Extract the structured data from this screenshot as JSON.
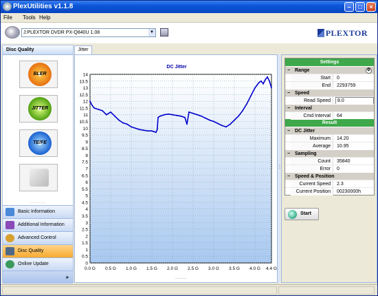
{
  "window": {
    "title": "PlexUtilities v1.1.8"
  },
  "menu": {
    "file": "File",
    "tools": "Tools",
    "help": "Help"
  },
  "toolbar": {
    "drive": "J:PLEXTOR DVDR   PX-Q840U  1.08",
    "logo": "PLEXTOR"
  },
  "left": {
    "header": "Disc Quality",
    "buttons": {
      "bler": "BLER",
      "jitter": "JITTER",
      "tefe": "TE/FE"
    },
    "nav": [
      {
        "label": "Basic Information"
      },
      {
        "label": "Additional Information"
      },
      {
        "label": "Advanced Control"
      },
      {
        "label": "Disc Quality"
      },
      {
        "label": "Online Update"
      }
    ]
  },
  "tab": {
    "label": "Jitter"
  },
  "chart_data": {
    "type": "line",
    "title": "DC Jitter",
    "xlabel": "",
    "ylabel": "",
    "x_ticks": [
      "0.0 G",
      "0.5 G",
      "1.0 G",
      "1.5 G",
      "2.0 G",
      "2.5 G",
      "3.0 G",
      "3.5 G",
      "4.0 G",
      "4.4 G"
    ],
    "x_tick_values": [
      0,
      0.5,
      1.0,
      1.5,
      2.0,
      2.5,
      3.0,
      3.5,
      4.0,
      4.4
    ],
    "xlim": [
      0,
      4.4
    ],
    "ylim": [
      0,
      14
    ],
    "y_ticks": [
      "0",
      "0.5",
      "1",
      "1.5",
      "2",
      "2.5",
      "3",
      "3.5",
      "4",
      "4.5",
      "5",
      "5.5",
      "6",
      "6.5",
      "7",
      "7.5",
      "8",
      "8.5",
      "9",
      "9.5",
      "10",
      "10.5",
      "11",
      "11.5",
      "12",
      "12.5",
      "13",
      "13.5",
      "14"
    ],
    "grid": true,
    "series": [
      {
        "color": "#0000cc",
        "x": [
          0.0,
          0.05,
          0.1,
          0.2,
          0.3,
          0.4,
          0.5,
          0.6,
          0.7,
          0.8,
          0.9,
          1.0,
          1.1,
          1.2,
          1.3,
          1.4,
          1.5,
          1.55,
          1.6,
          1.63,
          1.65,
          1.7,
          1.8,
          1.9,
          2.0,
          2.1,
          2.2,
          2.3,
          2.35,
          2.4,
          2.5,
          2.6,
          2.7,
          2.8,
          2.9,
          3.0,
          3.1,
          3.2,
          3.3,
          3.4,
          3.5,
          3.6,
          3.7,
          3.8,
          3.9,
          4.0,
          4.05,
          4.1,
          4.15,
          4.2,
          4.25,
          4.3,
          4.35,
          4.4
        ],
        "y": [
          12.0,
          11.7,
          11.5,
          11.4,
          11.3,
          11.0,
          11.2,
          10.9,
          10.6,
          10.4,
          10.3,
          10.1,
          10.0,
          9.9,
          9.85,
          9.8,
          9.8,
          9.75,
          9.7,
          9.9,
          10.8,
          10.9,
          11.0,
          11.05,
          11.0,
          10.95,
          10.9,
          10.8,
          10.3,
          11.2,
          11.1,
          11.0,
          10.9,
          10.75,
          10.6,
          10.5,
          10.35,
          10.2,
          10.1,
          10.3,
          10.6,
          10.9,
          11.3,
          11.8,
          12.4,
          13.0,
          13.2,
          13.4,
          13.5,
          13.3,
          13.6,
          13.8,
          13.5,
          13.0
        ]
      }
    ]
  },
  "settings": {
    "header": "Settings",
    "range": "Range",
    "start_k": "Start",
    "start_v": "0",
    "end_k": "End",
    "end_v": "2293759",
    "speed": "Speed",
    "read_k": "Read Speed",
    "read_v": "8.0",
    "interval": "Interval",
    "cmd_k": "Cmd Interval",
    "cmd_v": "64"
  },
  "result": {
    "header": "Result",
    "dcj": "DC Jitter",
    "max_k": "Maximum",
    "max_v": "14.20",
    "avg_k": "Average",
    "avg_v": "10.95",
    "sampling": "Sampling",
    "count_k": "Count",
    "count_v": "35840",
    "err_k": "Error",
    "err_v": "0",
    "sp": "Speed & Position",
    "cs_k": "Current Speed",
    "cs_v": "2.3",
    "cp_k": "Current Position",
    "cp_v": "00230000h"
  },
  "start_button": "Start",
  "colors": {
    "accent": "#3ea84a",
    "line": "#0000cc",
    "active_nav": "#f7a930"
  }
}
